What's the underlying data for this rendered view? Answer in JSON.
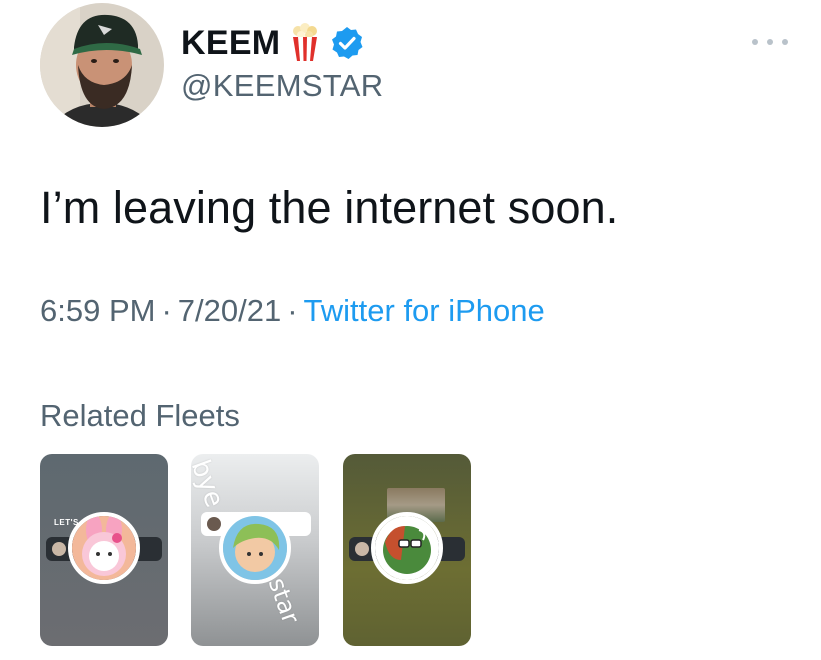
{
  "user": {
    "display_name": "KEEM",
    "handle": "@KEEMSTAR",
    "emoji_icon": "popcorn-icon",
    "verified": true,
    "verified_color": "#1d9bf0"
  },
  "tweet": {
    "text": "I’m leaving the internet soon.",
    "time": "6:59 PM",
    "separator": "·",
    "date": "7/20/21",
    "source": "Twitter for iPhone"
  },
  "related_fleets": {
    "title": "Related Fleets",
    "items": [
      {
        "avatar_icon": "pink-character-avatar",
        "caption": "LET'S"
      },
      {
        "avatar_icon": "green-hair-character-avatar",
        "scribble_top": "bye",
        "scribble_bottom": "star"
      },
      {
        "avatar_icon": "green-ball-character-avatar"
      }
    ]
  },
  "colors": {
    "text_primary": "#0f1419",
    "text_secondary": "#536471",
    "link": "#1d9bf0"
  }
}
